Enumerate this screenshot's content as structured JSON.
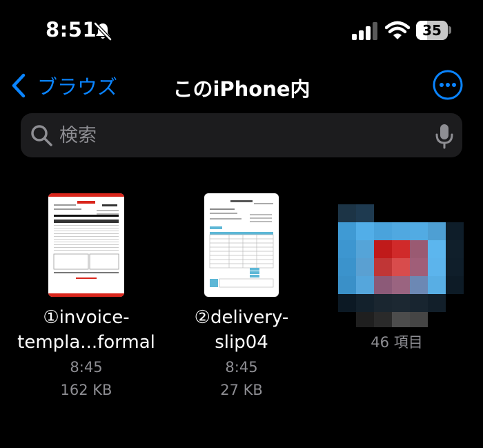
{
  "status_bar": {
    "time": "8:51",
    "battery_level": 35,
    "battery_text": "35"
  },
  "nav": {
    "back_label": "ブラウズ",
    "title": "このiPhone内"
  },
  "search": {
    "placeholder": "検索"
  },
  "files": [
    {
      "name_line1": "①invoice-",
      "name_line2": "templa...formal",
      "time": "8:45",
      "size": "162 KB"
    },
    {
      "name_line1": "②delivery-",
      "name_line2": "slip04",
      "time": "8:45",
      "size": "27 KB"
    }
  ],
  "folder": {
    "count": "46 項目"
  },
  "colors": {
    "accent": "#0a84ff",
    "secondary_text": "#8e8e93",
    "search_bg": "#1c1c1e"
  },
  "icons": [
    "bell-slash-icon",
    "cellular-signal-icon",
    "wifi-icon",
    "battery-icon",
    "chevron-left-icon",
    "ellipsis-circle-icon",
    "magnifying-glass-icon",
    "microphone-icon"
  ]
}
